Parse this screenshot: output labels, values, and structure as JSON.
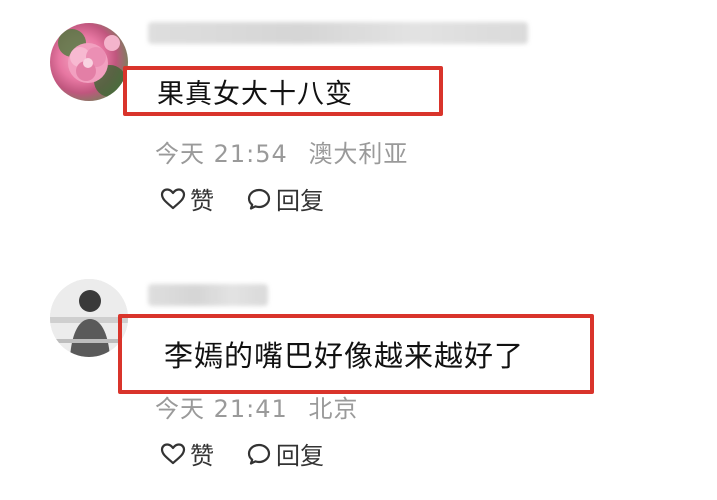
{
  "comments": [
    {
      "content": "果真女大十八变",
      "time": "今天 21:54",
      "location": "澳大利亚",
      "like_label": "赞",
      "reply_label": "回复"
    },
    {
      "content": "李嫣的嘴巴好像越来越好了",
      "time": "今天 21:41",
      "location": "北京",
      "like_label": "赞",
      "reply_label": "回复"
    }
  ],
  "colors": {
    "highlight_border": "#d9342b",
    "meta_text": "#9a9a9a"
  },
  "icons": {
    "like": "heart-icon",
    "reply": "speech-bubble-icon"
  }
}
